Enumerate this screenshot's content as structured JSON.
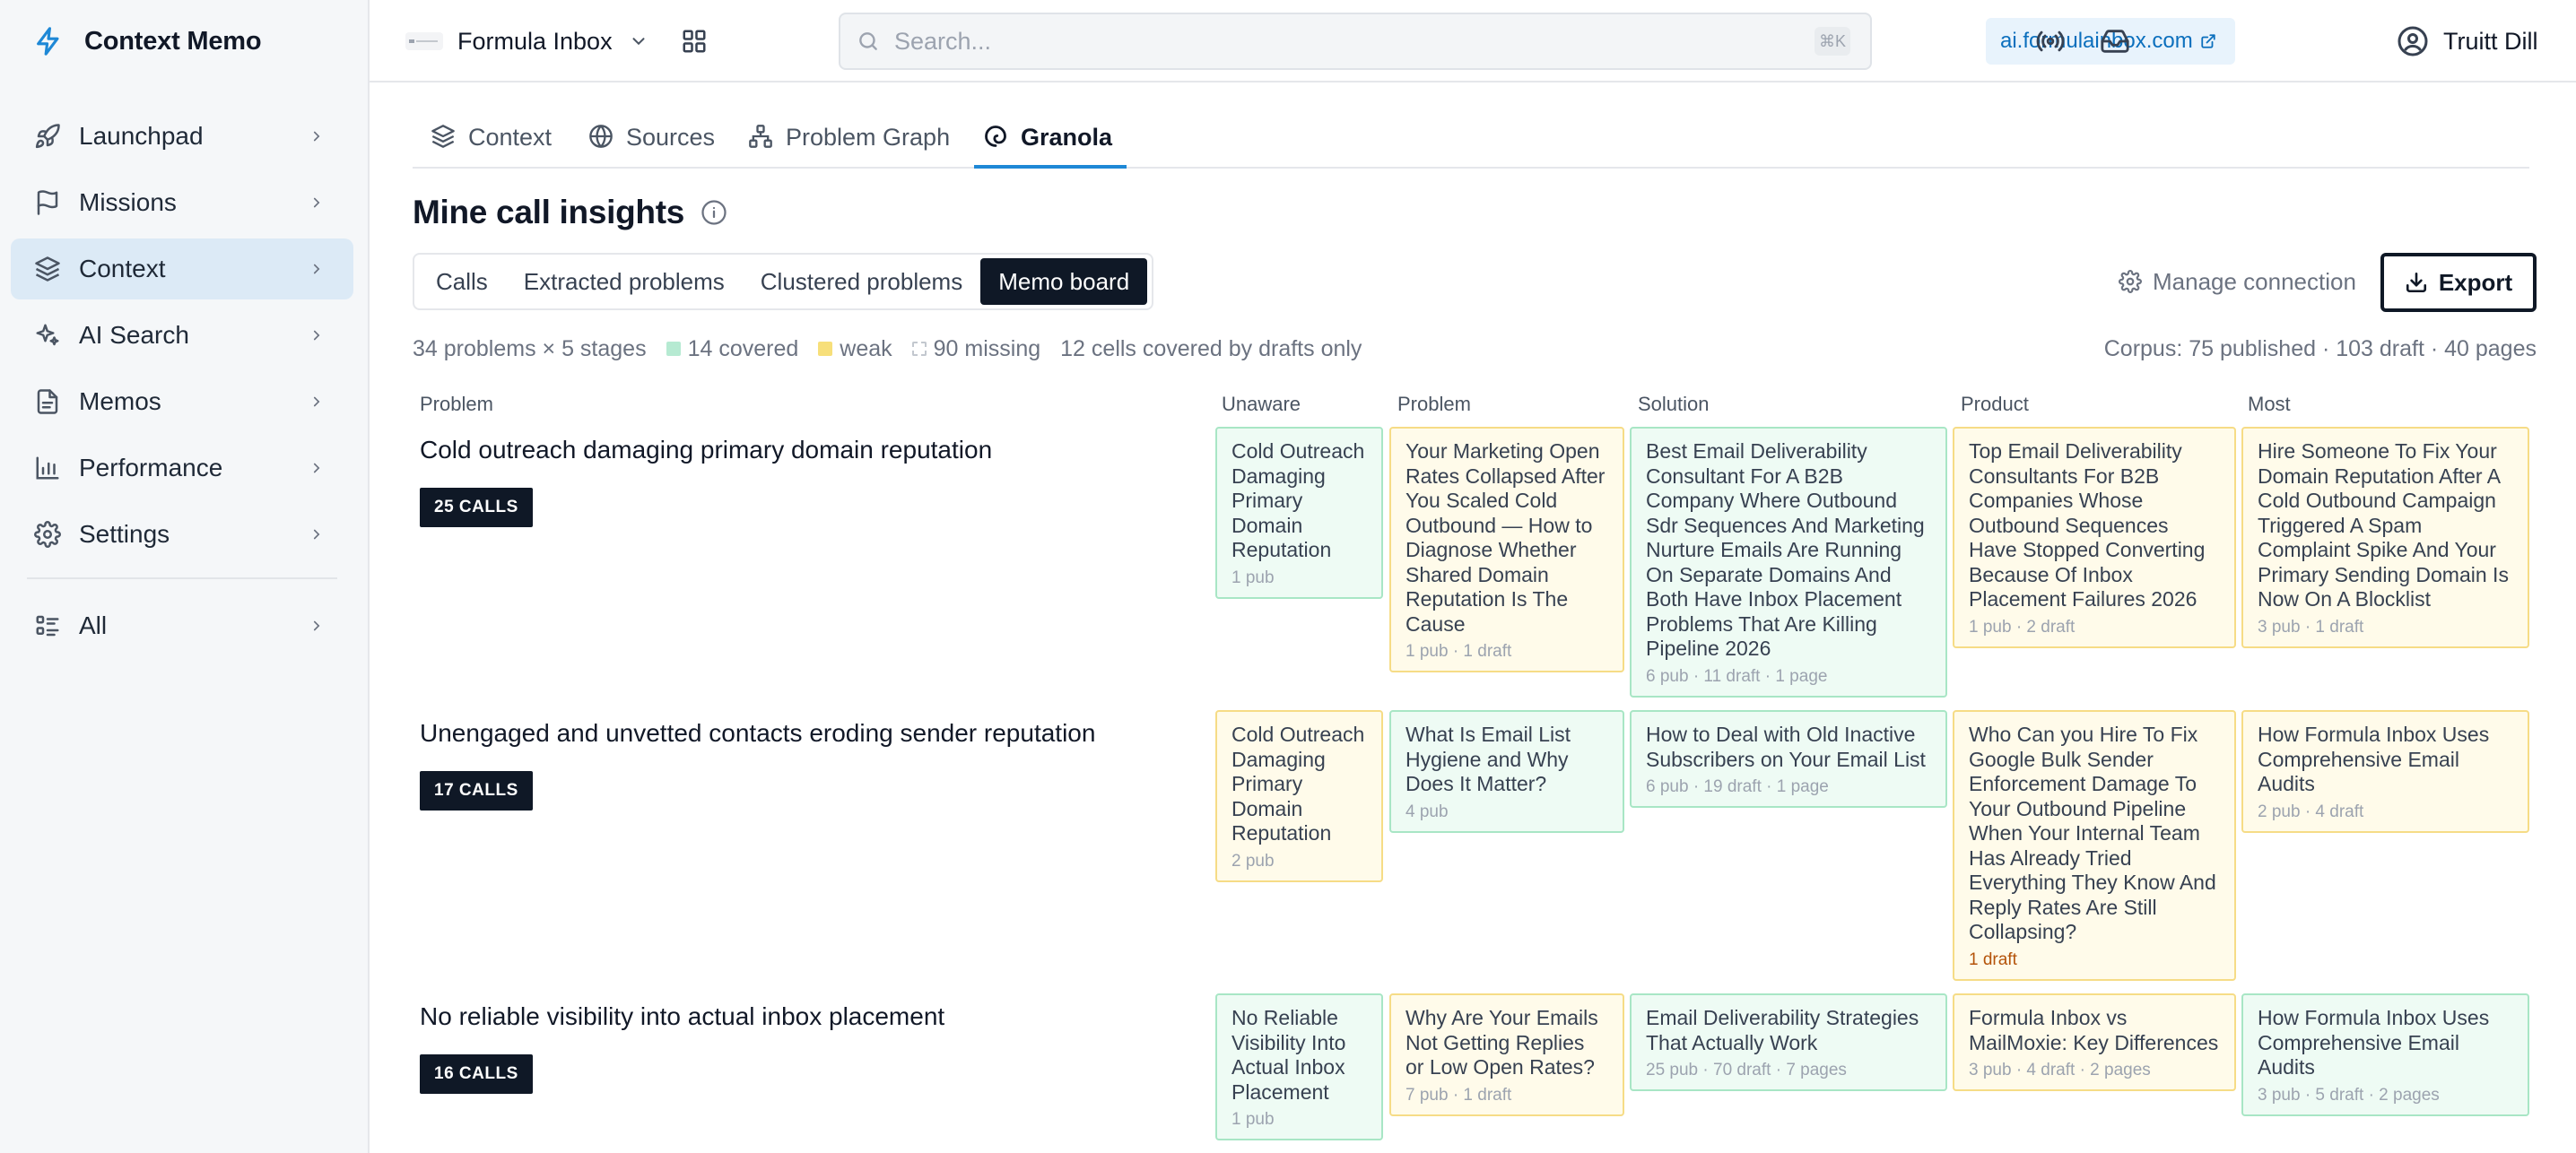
{
  "app": {
    "name": "Context Memo"
  },
  "sidebar": {
    "items": [
      {
        "label": "Launchpad",
        "icon": "rocket-icon"
      },
      {
        "label": "Missions",
        "icon": "flag-icon"
      },
      {
        "label": "Context",
        "icon": "layers-icon",
        "active": true
      },
      {
        "label": "AI Search",
        "icon": "sparkle-icon"
      },
      {
        "label": "Memos",
        "icon": "document-icon"
      },
      {
        "label": "Performance",
        "icon": "bar-chart-icon"
      },
      {
        "label": "Settings",
        "icon": "gear-icon"
      }
    ],
    "all_label": "All"
  },
  "topbar": {
    "workspace": "Formula Inbox",
    "search_placeholder": "Search...",
    "search_shortcut": "⌘K",
    "domain": "ai.formulainbox.com",
    "user": "Truitt Dill"
  },
  "tabs": [
    {
      "label": "Context",
      "icon": "layers-icon"
    },
    {
      "label": "Sources",
      "icon": "globe-icon"
    },
    {
      "label": "Problem Graph",
      "icon": "graph-icon"
    },
    {
      "label": "Granola",
      "icon": "granola-icon",
      "active": true
    }
  ],
  "page": {
    "title": "Mine call insights"
  },
  "segments": [
    {
      "label": "Calls"
    },
    {
      "label": "Extracted problems"
    },
    {
      "label": "Clustered problems"
    },
    {
      "label": "Memo board",
      "active": true
    }
  ],
  "actions": {
    "manage": "Manage connection",
    "export": "Export"
  },
  "stats": {
    "dims": "34 problems × 5 stages",
    "covered": "14 covered",
    "weak": "weak",
    "missing": "90 missing",
    "drafts": "12 cells covered by drafts only",
    "corpus": "Corpus: 75 published · 103 draft · 40 pages"
  },
  "columns": [
    "Problem",
    "Unaware",
    "Problem",
    "Solution",
    "Product",
    "Most"
  ],
  "colors": {
    "covered": "#eefbf4",
    "weak": "#fffbea",
    "accent": "#1e88d6",
    "dark": "#0f1826"
  },
  "rows": [
    {
      "title": "Cold outreach damaging primary domain reputation",
      "calls": "25 CALLS",
      "cells": [
        {
          "title": "Cold Outreach Damaging Primary Domain Reputation",
          "meta": "1 pub",
          "status": "covered"
        },
        {
          "title": "Your Marketing Open Rates Collapsed After You Scaled Cold Outbound — How to Diagnose Whether Shared Domain Reputation Is The Cause",
          "meta": "1 pub · 1 draft",
          "status": "weak"
        },
        {
          "title": "Best Email Deliverability Consultant For A B2B Company Where Outbound Sdr Sequences And Marketing Nurture Emails Are Running On Separate Domains And Both Have Inbox Placement Problems That Are Killing Pipeline 2026",
          "meta": "6 pub · 11 draft · 1 page",
          "status": "covered"
        },
        {
          "title": "Top Email Deliverability Consultants For B2B Companies Whose Outbound Sequences Have Stopped Converting Because Of Inbox Placement Failures 2026",
          "meta": "1 pub · 2 draft",
          "status": "weak"
        },
        {
          "title": "Hire Someone To Fix Your Domain Reputation After A Cold Outbound Campaign Triggered A Spam Complaint Spike And Your Primary Sending Domain Is Now On A Blocklist",
          "meta": "3 pub · 1 draft",
          "status": "weak"
        }
      ]
    },
    {
      "title": "Unengaged and unvetted contacts eroding sender reputation",
      "calls": "17 CALLS",
      "cells": [
        {
          "title": "Cold Outreach Damaging Primary Domain Reputation",
          "meta": "2 pub",
          "status": "weak"
        },
        {
          "title": "What Is Email List Hygiene and Why Does It Matter?",
          "meta": "4 pub",
          "status": "covered"
        },
        {
          "title": "How to Deal with Old Inactive Subscribers on Your Email List",
          "meta": "6 pub · 19 draft · 1 page",
          "status": "covered"
        },
        {
          "title": "Who Can you Hire To Fix Google Bulk Sender Enforcement Damage To Your Outbound Pipeline When Your Internal Team Has Already Tried Everything They Know And Reply Rates Are Still Collapsing?",
          "meta": "1 draft",
          "status": "weak",
          "warn": true
        },
        {
          "title": "How Formula Inbox Uses Comprehensive Email Audits",
          "meta": "2 pub · 4 draft",
          "status": "weak"
        }
      ]
    },
    {
      "title": "No reliable visibility into actual inbox placement",
      "calls": "16 CALLS",
      "cells": [
        {
          "title": "No Reliable Visibility Into Actual Inbox Placement",
          "meta": "1 pub",
          "status": "covered"
        },
        {
          "title": "Why Are Your Emails Not Getting Replies or Low Open Rates?",
          "meta": "7 pub · 1 draft",
          "status": "weak"
        },
        {
          "title": "Email Deliverability Strategies That Actually Work",
          "meta": "25 pub · 70 draft · 7 pages",
          "status": "covered"
        },
        {
          "title": "Formula Inbox vs MailMoxie: Key Differences",
          "meta": "3 pub · 4 draft · 2 pages",
          "status": "weak"
        },
        {
          "title": "How Formula Inbox Uses Comprehensive Email Audits",
          "meta": "3 pub · 5 draft · 2 pages",
          "status": "covered"
        }
      ]
    }
  ]
}
